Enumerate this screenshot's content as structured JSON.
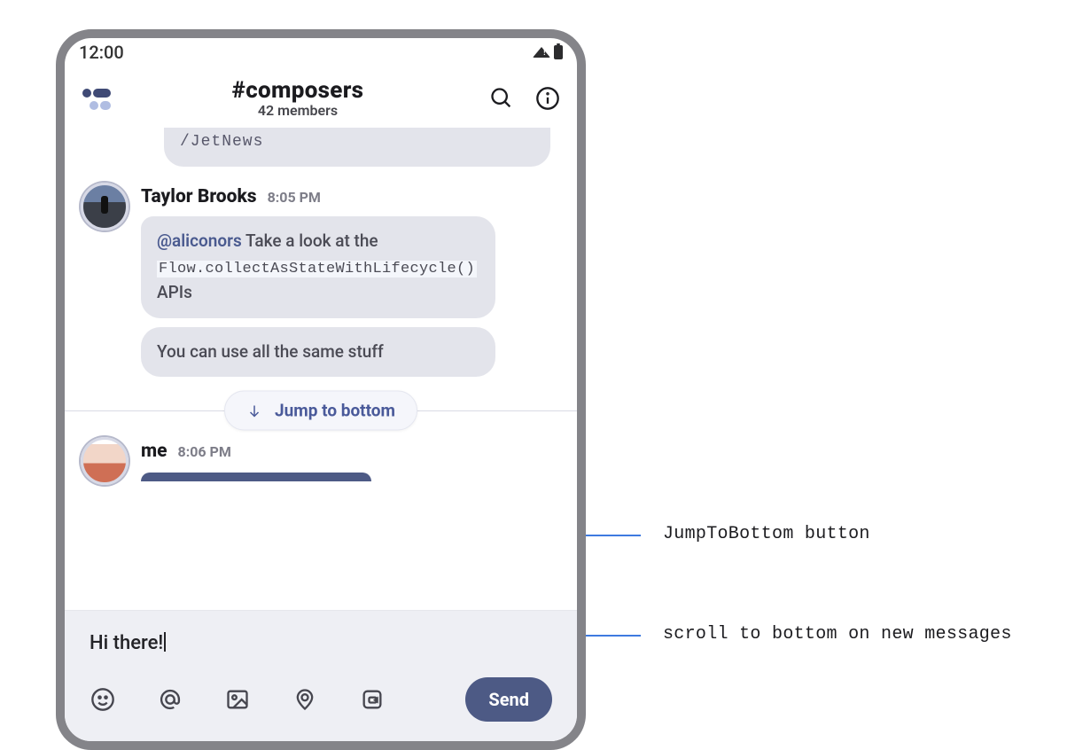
{
  "status": {
    "time": "12:00"
  },
  "header": {
    "channel": "#composers",
    "members": "42 members"
  },
  "messages": {
    "truncated": "/JetNews",
    "taylor": {
      "name": "Taylor Brooks",
      "time": "8:05 PM",
      "m1_mention": "@aliconors",
      "m1_text1": " Take a look at the ",
      "m1_code": "Flow.collectAsStateWithLifecycle()",
      "m1_text2": " APIs",
      "m2": "You can use all the same stuff"
    },
    "jump": "Jump to bottom",
    "me": {
      "name": "me",
      "time": "8:06 PM"
    }
  },
  "composer": {
    "draft": "Hi there!",
    "send": "Send"
  },
  "annotations": {
    "a1": "JumpToBottom button",
    "a2": "scroll to bottom on new messages"
  }
}
